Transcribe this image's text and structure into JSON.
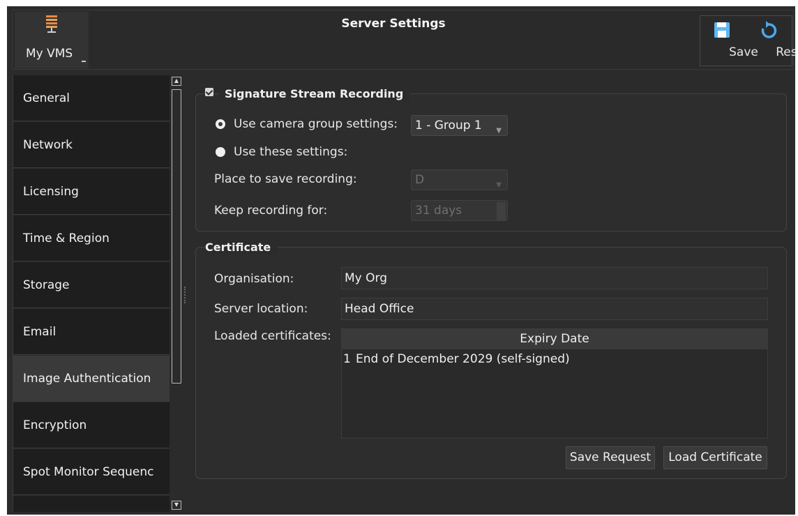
{
  "app": {
    "name": "My VMS",
    "title": "Server Settings"
  },
  "toolbar": {
    "save_label": "Save",
    "reset_label": "Reset"
  },
  "sidebar": {
    "items": [
      {
        "label": "General",
        "active": false
      },
      {
        "label": "Network",
        "active": false
      },
      {
        "label": "Licensing",
        "active": false
      },
      {
        "label": "Time & Region",
        "active": false
      },
      {
        "label": "Storage",
        "active": false
      },
      {
        "label": "Email",
        "active": false
      },
      {
        "label": "Image Authentication",
        "active": true
      },
      {
        "label": "Encryption",
        "active": false
      },
      {
        "label": "Spot Monitor Sequenc",
        "active": false
      }
    ]
  },
  "signature": {
    "title": "Signature Stream Recording",
    "enabled": true,
    "use_group_label": "Use camera group settings:",
    "group_value": "1 - Group 1",
    "use_these_label": "Use these settings:",
    "place_label": "Place to save recording:",
    "place_value": "D",
    "keep_label": "Keep recording for:",
    "keep_value": "31 days"
  },
  "certificate": {
    "title": "Certificate",
    "org_label": "Organisation:",
    "org_value": "My Org",
    "location_label": "Server location:",
    "location_value": "Head Office",
    "loaded_label": "Loaded certificates:",
    "table_header": "Expiry Date",
    "rows": [
      {
        "index": "1",
        "expiry": "End of December 2029 (self-signed)"
      }
    ],
    "save_request_label": "Save Request",
    "load_certificate_label": "Load Certificate"
  },
  "colors": {
    "background": "#2b2b2b",
    "sidebar_item": "#1e1e1e",
    "sidebar_active": "#3a3a3a",
    "save_icon": "#5db8f0",
    "reset_icon": "#4aa8ec"
  }
}
